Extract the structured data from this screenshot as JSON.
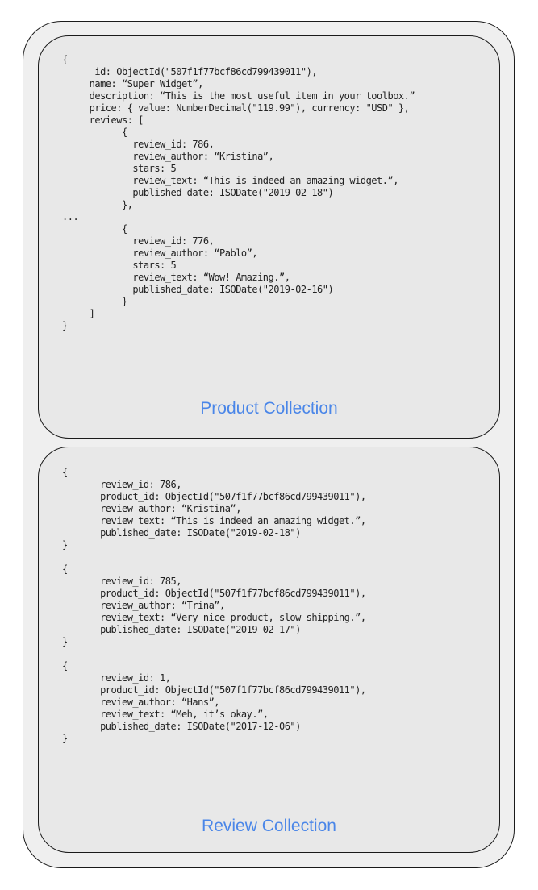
{
  "product_collection": {
    "label": "Product Collection",
    "document": "{\n     _id: ObjectId(\"507f1f77bcf86cd799439011\"),\n     name: “Super Widget”,\n     description: “This is the most useful item in your toolbox.”\n     price: { value: NumberDecimal(\"119.99\"), currency: \"USD\" },\n     reviews: [\n           {\n             review_id: 786,\n             review_author: “Kristina”,\n             stars: 5\n             review_text: “This is indeed an amazing widget.”,\n             published_date: ISODate(\"2019-02-18\")\n           },\n...\n           {\n             review_id: 776,\n             review_author: “Pablo”,\n             stars: 5\n             review_text: “Wow! Amazing.”,\n             published_date: ISODate(\"2019-02-16\")\n           }\n     ]\n}"
  },
  "review_collection": {
    "label": "Review Collection",
    "documents": [
      "{\n       review_id: 786,\n       product_id: ObjectId(\"507f1f77bcf86cd799439011\"),\n       review_author: “Kristina”,\n       review_text: “This is indeed an amazing widget.”,\n       published_date: ISODate(\"2019-02-18\")\n}",
      "{\n       review_id: 785,\n       product_id: ObjectId(\"507f1f77bcf86cd799439011\"),\n       review_author: “Trina”,\n       review_text: “Very nice product, slow shipping.”,\n       published_date: ISODate(\"2019-02-17\")\n}",
      "{\n       review_id: 1,\n       product_id: ObjectId(\"507f1f77bcf86cd799439011\"),\n       review_author: “Hans”,\n       review_text: “Meh, it’s okay.”,\n       published_date: ISODate(\"2017-12-06\")\n}"
    ]
  }
}
